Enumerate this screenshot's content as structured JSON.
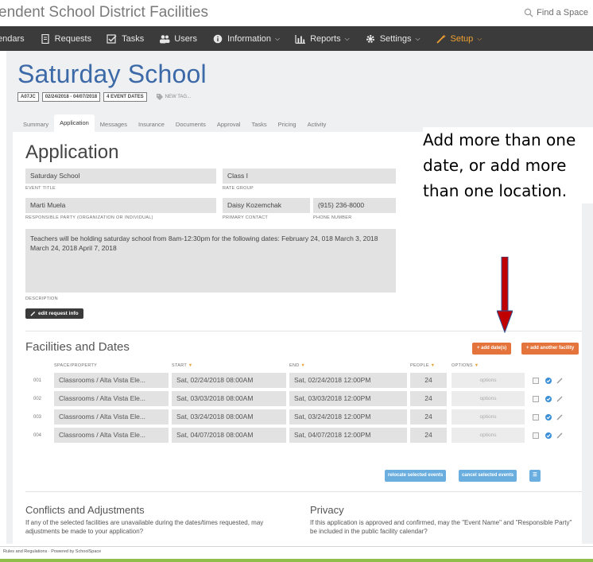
{
  "header": {
    "district_title": "endent School District Facilities",
    "find_space": "Find a Space"
  },
  "nav": {
    "items": [
      {
        "label": "endars",
        "icon": "none"
      },
      {
        "label": "Requests",
        "icon": "request-doc-icon"
      },
      {
        "label": "Tasks",
        "icon": "checkbox-icon"
      },
      {
        "label": "Users",
        "icon": "users-icon"
      },
      {
        "label": "Information",
        "icon": "info-icon"
      },
      {
        "label": "Reports",
        "icon": "bar-chart-icon"
      },
      {
        "label": "Settings",
        "icon": "gear-icon"
      },
      {
        "label": "Setup",
        "icon": "wand-icon"
      }
    ]
  },
  "event": {
    "title": "Saturday School",
    "badges": [
      "A07JC",
      "02/24/2018 - 04/07/2018",
      "4 EVENT DATES"
    ],
    "new_tag": "NEW TAG..."
  },
  "tabs": [
    "Summary",
    "Application",
    "Messages",
    "Insurance",
    "Documents",
    "Approval",
    "Tasks",
    "Pricing",
    "Activity"
  ],
  "application": {
    "heading": "Application",
    "event_title": {
      "value": "Saturday School",
      "label": "EVENT TITLE"
    },
    "rate_group": {
      "value": "Class I",
      "label": "RATE GROUP"
    },
    "responsible": {
      "value": "Marti Muela",
      "label": "RESPONSIBLE PARTY (ORGANIZATION OR INDIVIDUAL)"
    },
    "primary_contact": {
      "value": "Daisy Kozemchak",
      "label": "PRIMARY CONTACT"
    },
    "phone": {
      "value": "(915) 236-8000",
      "label": "PHONE NUMBER"
    },
    "description": {
      "value": "Teachers will be holding saturday school from 8am-12:30pm for the following dates: February 24, 018 March 3, 2018 March 24, 2018 April 7, 2018",
      "label": "DESCRIPTION"
    },
    "edit_button": "edit request info"
  },
  "facilities": {
    "heading": "Facilities and Dates",
    "add_dates": "+ add date(s)",
    "add_facility": "+ add another facility",
    "columns": {
      "space": "SPACE/PROPERTY",
      "start": "START",
      "end": "END",
      "people": "PEOPLE",
      "options": "OPTIONS"
    },
    "rows": [
      {
        "num": "001",
        "space": "Classrooms / Alta Vista Ele...",
        "start": "Sat, 02/24/2018 08:00AM",
        "end": "Sat, 02/24/2018 12:00PM",
        "people": "24",
        "options": "options"
      },
      {
        "num": "002",
        "space": "Classrooms / Alta Vista Ele...",
        "start": "Sat, 03/03/2018 08:00AM",
        "end": "Sat, 03/03/2018 12:00PM",
        "people": "24",
        "options": "options"
      },
      {
        "num": "003",
        "space": "Classrooms / Alta Vista Ele...",
        "start": "Sat, 03/24/2018 08:00AM",
        "end": "Sat, 03/24/2018 12:00PM",
        "people": "24",
        "options": "options"
      },
      {
        "num": "004",
        "space": "Classrooms / Alta Vista Ele...",
        "start": "Sat, 04/07/2018 08:00AM",
        "end": "Sat, 04/07/2018 12:00PM",
        "people": "24",
        "options": "options"
      }
    ],
    "relocate": "relocate selected events",
    "cancel": "cancel selected events"
  },
  "conflicts": {
    "heading": "Conflicts and Adjustments",
    "text": "If any of the selected facilities are unavailable during the dates/times requested, may adjustments be made to your application?"
  },
  "privacy": {
    "heading": "Privacy",
    "text": "If this application is approved and confirmed, may the \"Event Name\" and \"Responsible Party\" be included in the public facility calendar?"
  },
  "footer": {
    "text": "Rules and Regulations · Powered by SchoolSpace"
  },
  "callout": {
    "text": "Add more than one date, or add more than one location."
  },
  "colors": {
    "nav_bg": "#3b3b3b",
    "title_blue": "#3c6aa8",
    "orange": "#e4743b",
    "light_blue": "#6aaee0",
    "arrow_red": "#c00000",
    "footer_green": "#8fbf4a"
  }
}
